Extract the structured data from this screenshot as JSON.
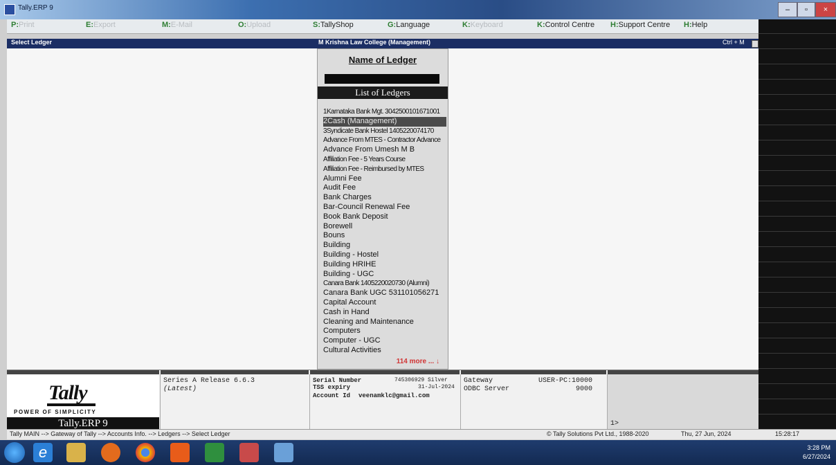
{
  "window": {
    "title": "Tally.ERP 9"
  },
  "menu": [
    {
      "key": "P:",
      "label": "Print",
      "dim": true
    },
    {
      "key": "E:",
      "label": "Export",
      "dim": true
    },
    {
      "key": "M:",
      "label": "E-Mail",
      "dim": true
    },
    {
      "key": "O:",
      "label": "Upload",
      "dim": true
    },
    {
      "key": "S:",
      "label": "TallyShop",
      "dim": false
    },
    {
      "key": "G:",
      "label": "Language",
      "dim": false
    },
    {
      "key": "K:",
      "label": "Keyboard",
      "dim": true
    },
    {
      "key": "K:",
      "label": "Control Centre",
      "dim": false
    },
    {
      "key": "H:",
      "label": "Support Centre",
      "dim": false
    },
    {
      "key": "H:",
      "label": "Help",
      "dim": false
    }
  ],
  "subheader": {
    "screen": "Select Ledger",
    "company": "M Krishna Law College (Management)",
    "shortcut": "Ctrl + M"
  },
  "popup": {
    "name_heading": "Name of Ledger",
    "list_heading": "List of Ledgers",
    "ledgers": [
      "1Karnataka Bank Mgt. 3042500101671001",
      "2Cash (Management)",
      "3Syndicate Bank Hostel 1405220074170",
      "Advance From MTES - Contractor Advance",
      "Advance From Umesh M B",
      "Affiliation Fee - 5 Years Course",
      "Affiliation Fee - Reimbursed by MTES",
      "Alumni Fee",
      "Audit Fee",
      "Bank Charges",
      "Bar-Council Renewal Fee",
      "Book Bank Deposit",
      "Borewell",
      "Bouns",
      "Building",
      "Building - Hostel",
      "Building HRIHE",
      "Building - UGC",
      "Canara Bank 1405220020730 (Alumni)",
      "Canara Bank UGC 531101056271",
      "Capital Account",
      "Cash in Hand",
      "Cleaning and Maintenance",
      "Computers",
      "Computer - UGC",
      "Cultural Activities"
    ],
    "selected_index": 1,
    "more": "114 more ... ↓"
  },
  "info": {
    "release": "Series A Release 6.6.3",
    "release_note": "(Latest)",
    "serial_label": "Serial Number",
    "serial_value": "745306929 Silver",
    "tss_label": "TSS expiry",
    "tss_value": "31-Jul-2024",
    "account_label": "Account Id",
    "account_value": "veenamklc@gmail.com",
    "gateway_label": "Gateway",
    "gateway_value": "USER-PC:10000",
    "odbc_label": "ODBC Server",
    "odbc_value": "9000",
    "prompt": "1>",
    "logo_script": "Tally",
    "power": "POWER OF SIMPLICITY",
    "product": "Tally.ERP 9"
  },
  "status": {
    "breadcrumb": "Tally MAIN --> Gateway of Tally --> Accounts Info. --> Ledgers --> Select Ledger",
    "copyright": "© Tally Solutions Pvt Ltd., 1988-2020",
    "date": "Thu, 27 Jun, 2024",
    "time": "15:28:17"
  },
  "taskbar": {
    "clock_time": "3:28 PM",
    "clock_date": "6/27/2024"
  }
}
